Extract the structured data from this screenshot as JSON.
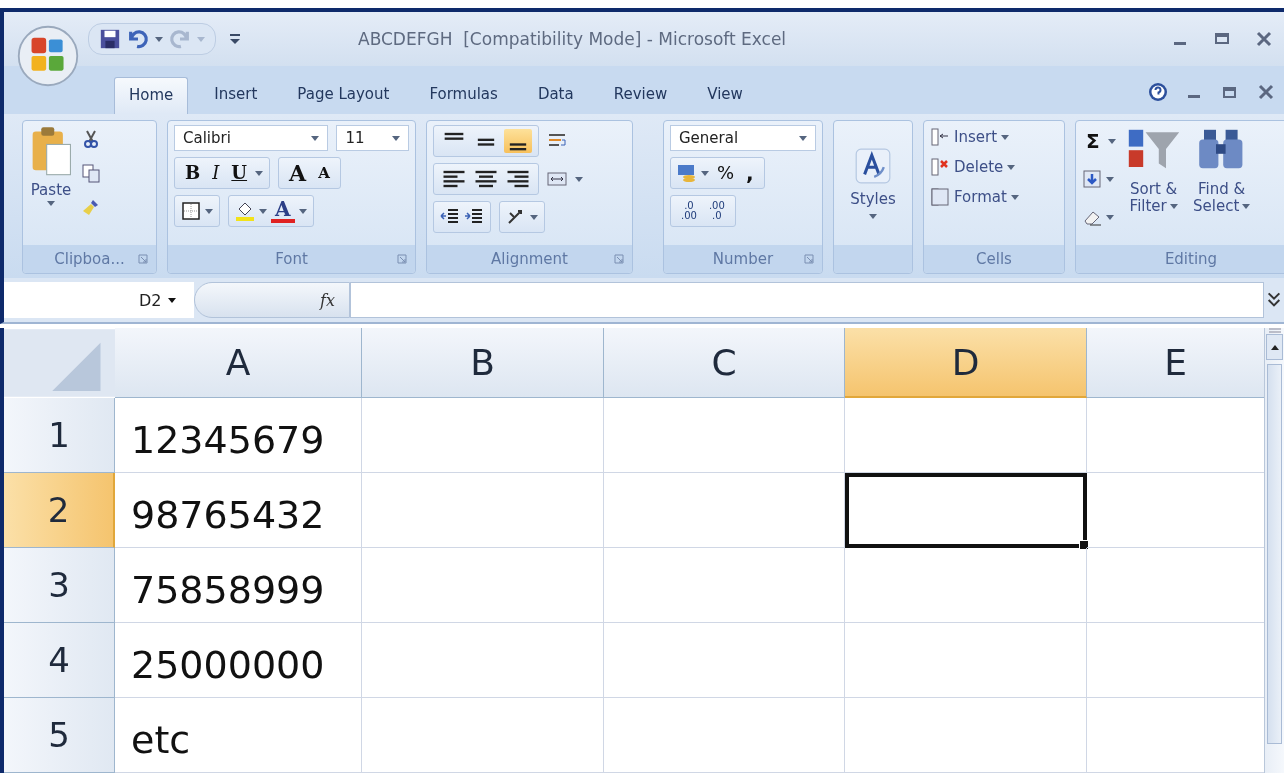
{
  "window": {
    "title": "ABCDEFGH  [Compatibility Mode] - Microsoft Excel"
  },
  "tabs": [
    {
      "label": "Home",
      "selected": true
    },
    {
      "label": "Insert",
      "selected": false
    },
    {
      "label": "Page Layout",
      "selected": false
    },
    {
      "label": "Formulas",
      "selected": false
    },
    {
      "label": "Data",
      "selected": false
    },
    {
      "label": "Review",
      "selected": false
    },
    {
      "label": "View",
      "selected": false
    }
  ],
  "ribbon": {
    "clipboard": {
      "label": "Clipboa...",
      "paste": "Paste"
    },
    "font": {
      "label": "Font",
      "font_name": "Calibri",
      "font_size": "11",
      "bold": "B",
      "italic": "I",
      "underline": "U",
      "grow": "A",
      "shrink": "A",
      "font_color": "A"
    },
    "alignment": {
      "label": "Alignment",
      "vertical": [
        {
          "kind": "top",
          "selected": false
        },
        {
          "kind": "middle",
          "selected": false
        },
        {
          "kind": "bottom",
          "selected": true
        }
      ],
      "horizontal": [
        {
          "kind": "left",
          "selected": false
        },
        {
          "kind": "center",
          "selected": false
        },
        {
          "kind": "right",
          "selected": false
        }
      ]
    },
    "number": {
      "label": "Number",
      "format": "General",
      "percent": "%",
      "comma": ",",
      "increase_decimal": [
        ".0",
        ".00"
      ],
      "decrease_decimal": [
        ".00",
        ".0"
      ]
    },
    "styles": {
      "label": "Styles"
    },
    "cells": {
      "label": "Cells",
      "items": [
        "Insert",
        "Delete",
        "Format"
      ]
    },
    "editing": {
      "label": "Editing",
      "sum": "Σ",
      "sort": [
        "Sort &",
        "Filter"
      ],
      "find": [
        "Find &",
        "Select"
      ]
    }
  },
  "formula_bar": {
    "name_box": "D2",
    "fx": "fx"
  },
  "sheet": {
    "columns": [
      {
        "label": "A",
        "selected": false
      },
      {
        "label": "B",
        "selected": false
      },
      {
        "label": "C",
        "selected": false
      },
      {
        "label": "D",
        "selected": true
      },
      {
        "label": "E",
        "selected": false
      }
    ],
    "rows": [
      {
        "label": "1",
        "selected": false,
        "cells": [
          {
            "text": "12345679",
            "active": false
          },
          {
            "active": false
          },
          {
            "active": false
          },
          {
            "active": false
          },
          {
            "active": false
          }
        ]
      },
      {
        "label": "2",
        "selected": true,
        "cells": [
          {
            "text": "98765432",
            "active": false
          },
          {
            "active": false
          },
          {
            "active": false
          },
          {
            "active": true
          },
          {
            "active": false
          }
        ]
      },
      {
        "label": "3",
        "selected": false,
        "cells": [
          {
            "text": "75858999",
            "active": false
          },
          {
            "active": false
          },
          {
            "active": false
          },
          {
            "active": false
          },
          {
            "active": false
          }
        ]
      },
      {
        "label": "4",
        "selected": false,
        "cells": [
          {
            "text": "25000000",
            "active": false
          },
          {
            "active": false
          },
          {
            "active": false
          },
          {
            "active": false
          },
          {
            "active": false
          }
        ]
      },
      {
        "label": "5",
        "selected": false,
        "cells": [
          {
            "text": "etc",
            "active": false
          },
          {
            "active": false
          },
          {
            "active": false
          },
          {
            "active": false
          },
          {
            "active": false
          }
        ]
      }
    ]
  }
}
